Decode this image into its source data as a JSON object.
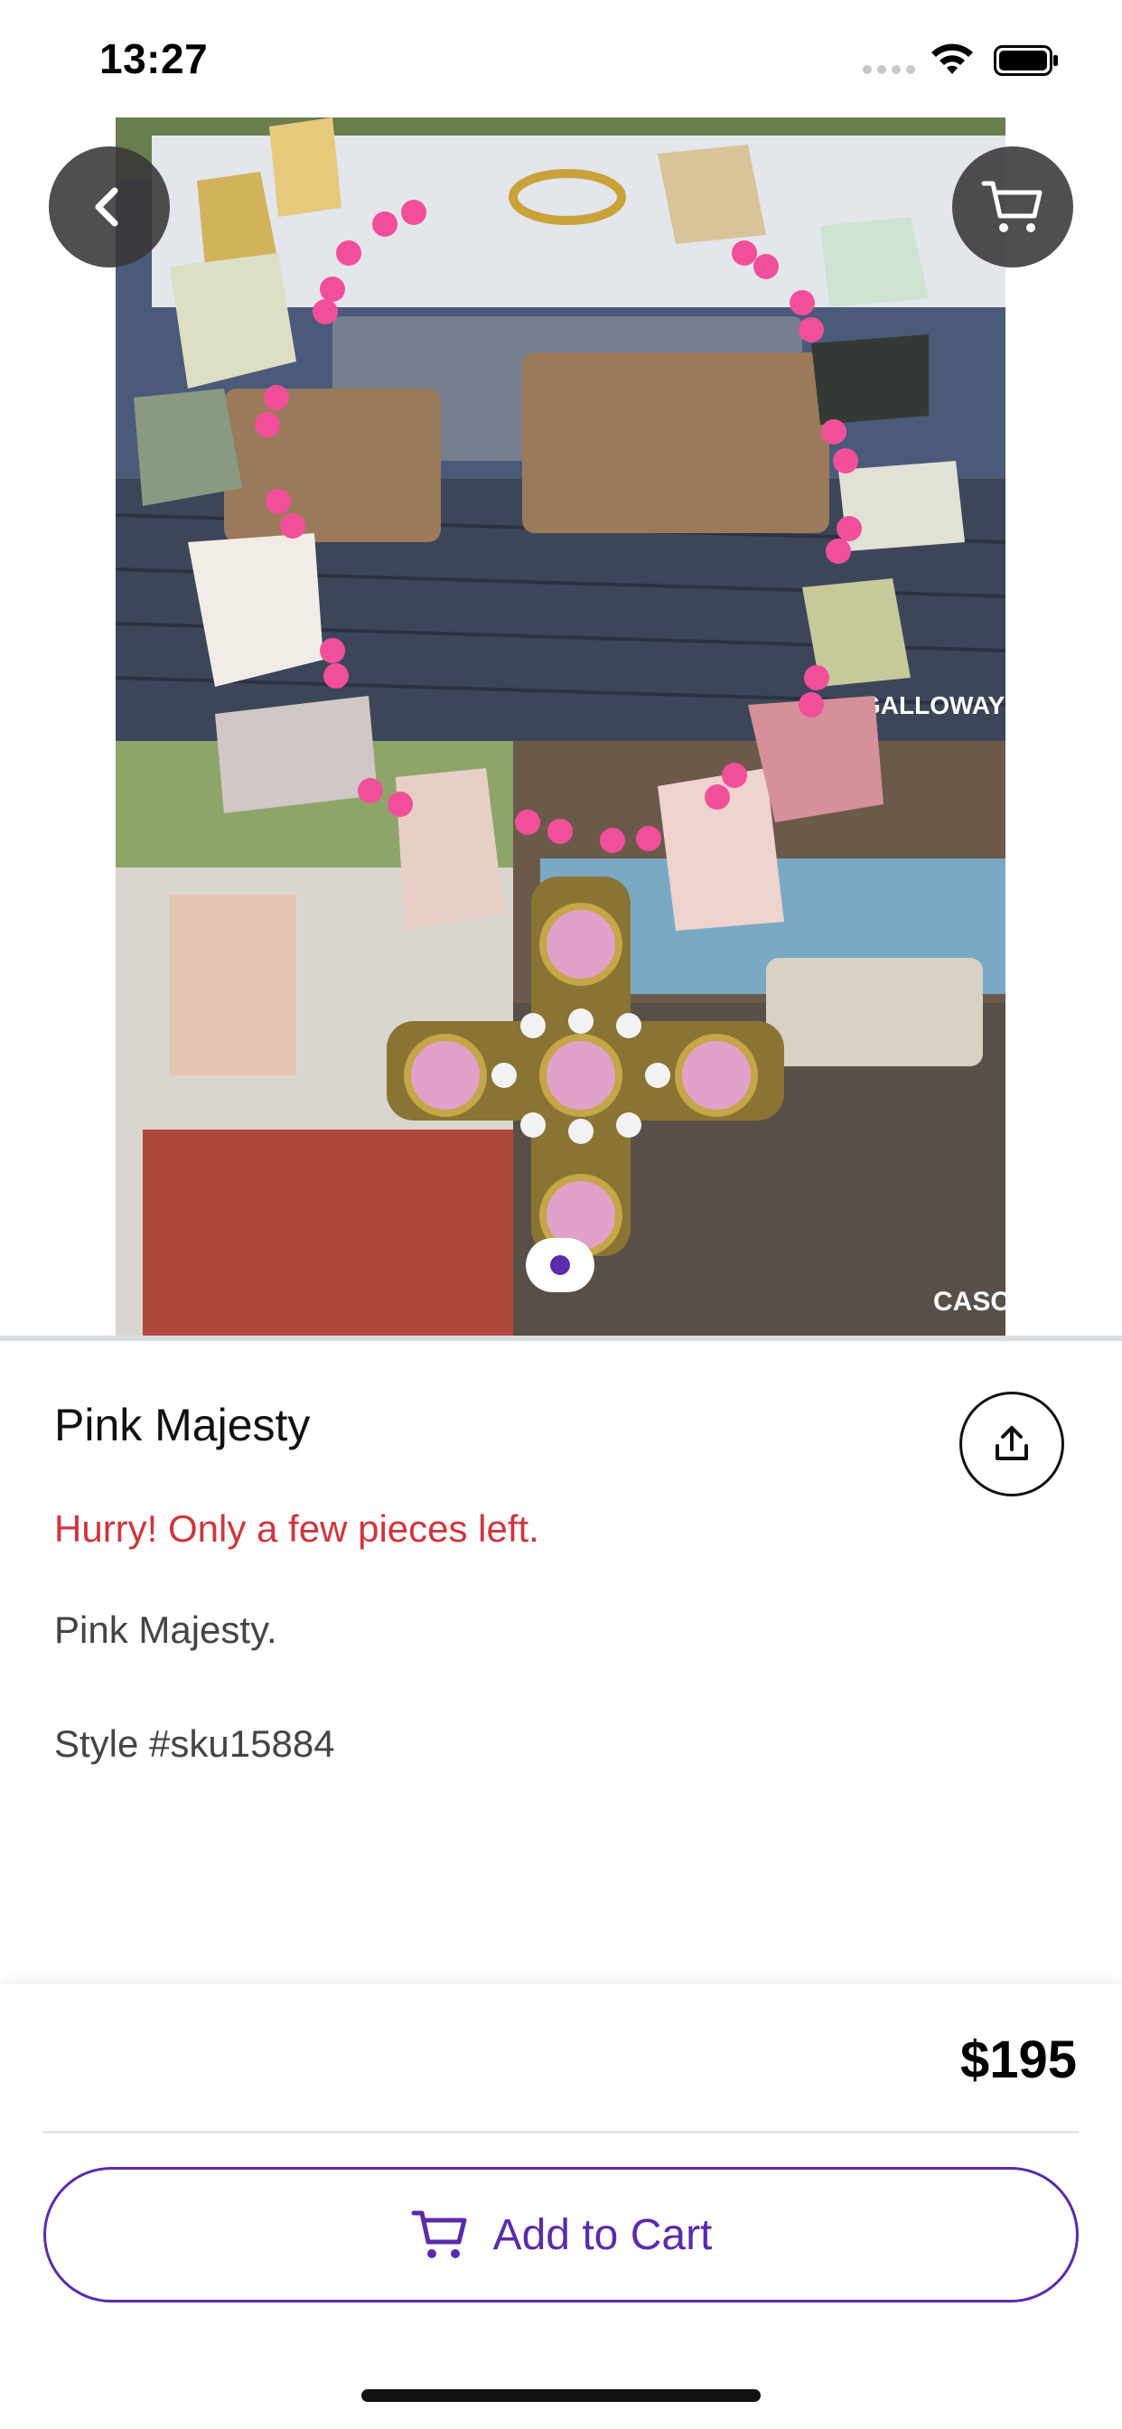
{
  "status_bar": {
    "time": "13:27",
    "icons": [
      "signal-dots-icon",
      "wifi-icon",
      "battery-icon"
    ]
  },
  "hero": {
    "image_description_icon": "product-photo",
    "page_count": 1,
    "current_page": 1,
    "back_icon": "chevron-left-icon",
    "cart_icon": "cart-icon",
    "overlay_texts": [
      "GALLOWAY",
      "CASC"
    ]
  },
  "product": {
    "title": "Pink Majesty",
    "stock_message": "Hurry! Only a few pieces left.",
    "description": "Pink Majesty.",
    "style_line": "Style #sku15884",
    "share_icon": "share-icon"
  },
  "purchase": {
    "price": "$195",
    "add_to_cart_label": "Add to Cart",
    "add_to_cart_icon": "cart-icon"
  },
  "colors": {
    "accent": "#5b2bab",
    "alert": "#d1343b",
    "text_secondary": "#444444"
  }
}
